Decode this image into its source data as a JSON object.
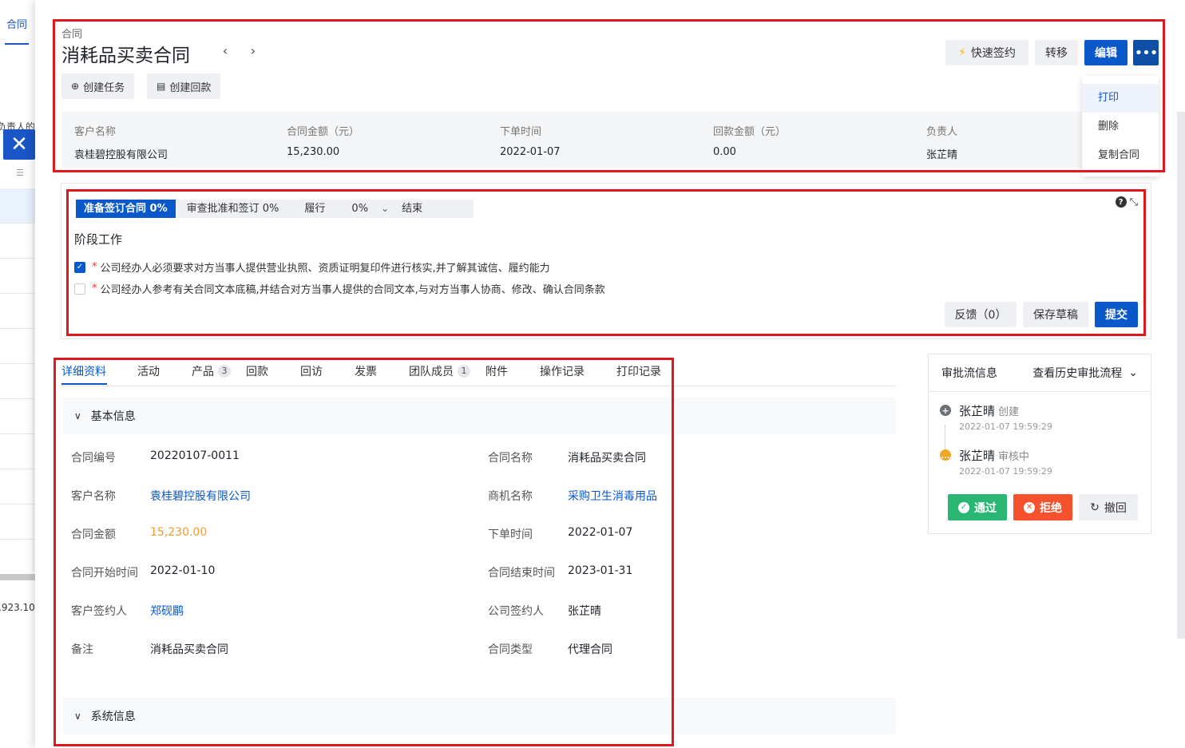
{
  "background": {
    "tab_label": "合同",
    "cut_text": "负责人的",
    "number_fragment": ",923.10"
  },
  "header": {
    "breadcrumb": "合同",
    "title": "消耗品买卖合同",
    "prev_icon": "chevron-left-icon",
    "next_icon": "chevron-right-icon",
    "create_task_label": "创建任务",
    "create_payment_label": "创建回款",
    "quick_sign_label": "快速签约",
    "transfer_label": "转移",
    "edit_label": "编辑",
    "more_label": "•••"
  },
  "more_menu": {
    "items": [
      "打印",
      "删除",
      "复制合同"
    ]
  },
  "summary": {
    "customer_label": "客户名称",
    "customer_value": "袁桂碧控股有限公司",
    "amount_label": "合同金额（元）",
    "amount_value": "15,230.00",
    "order_time_label": "下单时间",
    "order_time_value": "2022-01-07",
    "payment_label": "回款金额（元）",
    "payment_value": "0.00",
    "owner_label": "负责人",
    "owner_value": "张芷晴"
  },
  "stage_panel": {
    "stages": [
      {
        "label": "准备签订合同 0%",
        "active": true
      },
      {
        "label": "审查批准和签订 0%",
        "active": false
      },
      {
        "label": "履行        0%",
        "active": false
      },
      {
        "label": "结束",
        "active": false
      }
    ],
    "section_title": "阶段工作",
    "tasks": [
      {
        "text": "公司经办人必须要求对方当事人提供营业执照、资质证明复印件进行核实,并了解其诚信、履约能力",
        "checked": true
      },
      {
        "text": "公司经办人参考有关合同文本底稿,并结合对方当事人提供的合同文本,与对方当事人协商、修改、确认合同条款",
        "checked": false
      }
    ],
    "feedback_label": "反馈（0）",
    "save_draft_label": "保存草稿",
    "submit_label": "提交"
  },
  "tabs": [
    {
      "label": "详细资料",
      "badge": ""
    },
    {
      "label": "活动",
      "badge": ""
    },
    {
      "label": "产品",
      "badge": "3"
    },
    {
      "label": "回款",
      "badge": ""
    },
    {
      "label": "回访",
      "badge": ""
    },
    {
      "label": "发票",
      "badge": ""
    },
    {
      "label": "团队成员",
      "badge": "1"
    },
    {
      "label": "附件",
      "badge": ""
    },
    {
      "label": "操作记录",
      "badge": ""
    },
    {
      "label": "打印记录",
      "badge": ""
    }
  ],
  "basic_info": {
    "title": "基本信息",
    "fields": {
      "contract_no_label": "合同编号",
      "contract_no": "20220107-0011",
      "contract_name_label": "合同名称",
      "contract_name": "消耗品买卖合同",
      "customer_label": "客户名称",
      "customer": "袁桂碧控股有限公司",
      "opportunity_label": "商机名称",
      "opportunity": "采购卫生消毒用品",
      "amount_label": "合同金额",
      "amount": "15,230.00",
      "order_time_label": "下单时间",
      "order_time": "2022-01-07",
      "start_label": "合同开始时间",
      "start": "2022-01-10",
      "end_label": "合同结束时间",
      "end": "2023-01-31",
      "cust_signer_label": "客户签约人",
      "cust_signer": "郑砚鹛",
      "comp_signer_label": "公司签约人",
      "comp_signer": "张芷晴",
      "remark_label": "备注",
      "remark": "消耗品买卖合同",
      "type_label": "合同类型",
      "type": "代理合同"
    }
  },
  "system_info": {
    "title": "系统信息"
  },
  "approval": {
    "title": "审批流信息",
    "history_label": "查看历史审批流程",
    "steps": [
      {
        "name": "张芷晴",
        "status": "创建",
        "time": "2022-01-07 19:59:29"
      },
      {
        "name": "张芷晴",
        "status": "审核中",
        "time": "2022-01-07 19:59:29"
      }
    ],
    "approve_label": "通过",
    "reject_label": "拒绝",
    "revoke_label": "撤回"
  },
  "colors": {
    "primary": "#0a58ca",
    "approve": "#2bb673",
    "reject": "#f4512c",
    "annotation": "#e0191f"
  }
}
